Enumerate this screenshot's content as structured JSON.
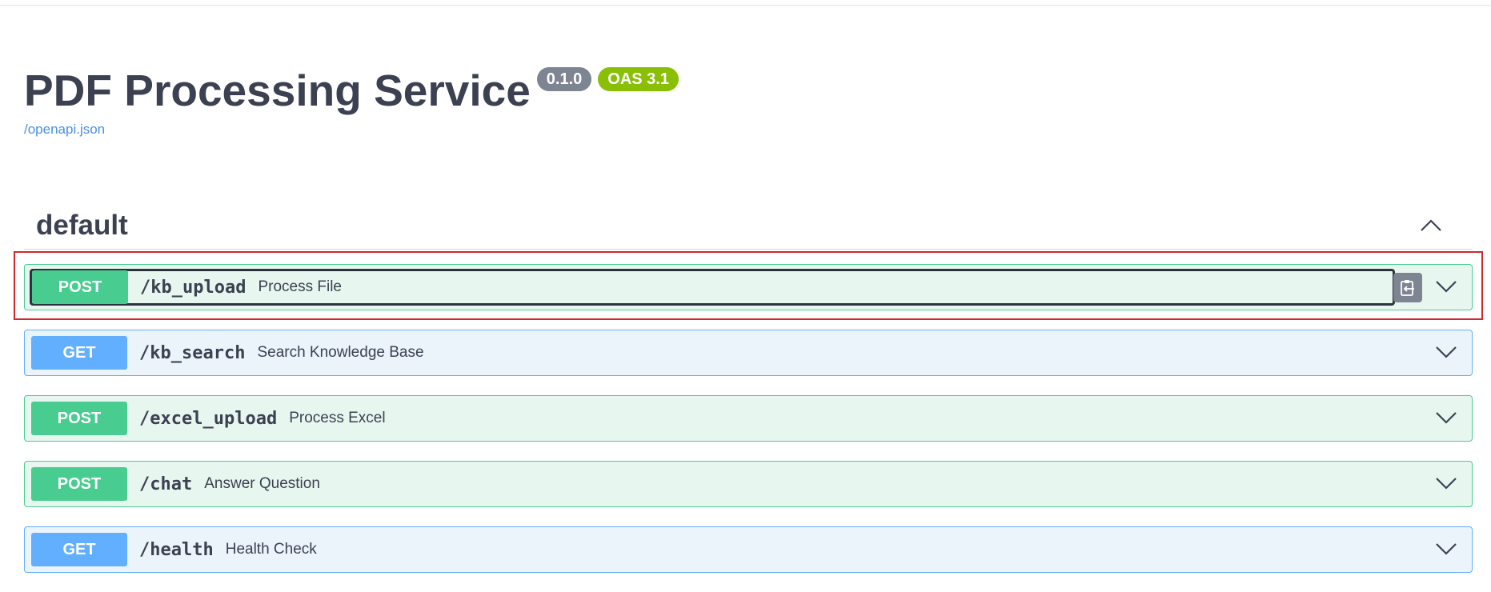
{
  "info": {
    "title": "PDF Processing Service",
    "version_badge": "0.1.0",
    "oas_badge": "OAS 3.1",
    "spec_link": "/openapi.json"
  },
  "tag": {
    "name": "default",
    "toggle_icon": "chevron-up-icon"
  },
  "operations": [
    {
      "method": "POST",
      "path": "/kb_upload",
      "summary": "Process File",
      "expand_icon": "chevron-down-icon",
      "copy_icon": "clipboard-icon"
    },
    {
      "method": "GET",
      "path": "/kb_search",
      "summary": "Search Knowledge Base",
      "expand_icon": "chevron-down-icon"
    },
    {
      "method": "POST",
      "path": "/excel_upload",
      "summary": "Process Excel",
      "expand_icon": "chevron-down-icon"
    },
    {
      "method": "POST",
      "path": "/chat",
      "summary": "Answer Question",
      "expand_icon": "chevron-down-icon"
    },
    {
      "method": "GET",
      "path": "/health",
      "summary": "Health Check",
      "expand_icon": "chevron-down-icon"
    }
  ],
  "colors": {
    "post": "#49cc90",
    "get": "#61affe",
    "version_badge": "#7d8492",
    "oas_badge": "#89bf04",
    "link": "#4990e2",
    "highlight": "#d0272f"
  }
}
